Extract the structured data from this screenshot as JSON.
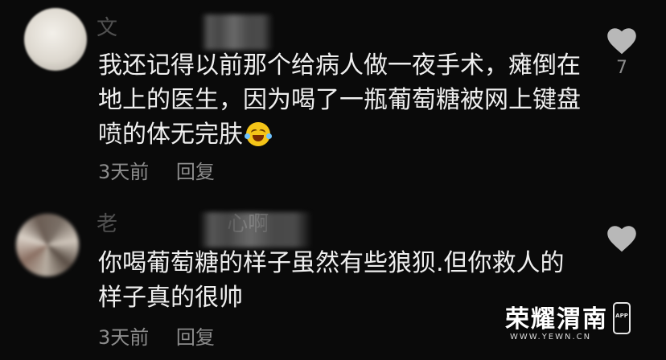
{
  "comments": [
    {
      "username": "文",
      "content_lines": [
        "我还记得以前那个给病人做一夜手术，瘫倒在",
        "地上的医生，因为喝了一瓶葡萄糖被网上键盘",
        "喷的体无完肤"
      ],
      "emoji": "laughing-crying-emoji",
      "time": "3天前",
      "reply_label": "回复",
      "like_count": "7"
    },
    {
      "username": "老",
      "username_tail": "心啊",
      "content_lines": [
        "你喝葡萄糖的样子虽然有些狼狈.但你救人的",
        "样子真的很帅"
      ],
      "time": "3天前",
      "reply_label": "回复",
      "like_count": ""
    }
  ],
  "watermark": {
    "title": "荣耀渭南",
    "url": "WWW.YEWN.CN",
    "app_label": "APP"
  },
  "colors": {
    "background": "#0a0a0a",
    "text": "#efefef",
    "secondary_text": "#8c8c8c",
    "heart": "#b8b8b8"
  },
  "icons": {
    "like": "heart-icon",
    "emoji": "laughing-crying-emoji",
    "watermark_app": "phone-icon"
  }
}
